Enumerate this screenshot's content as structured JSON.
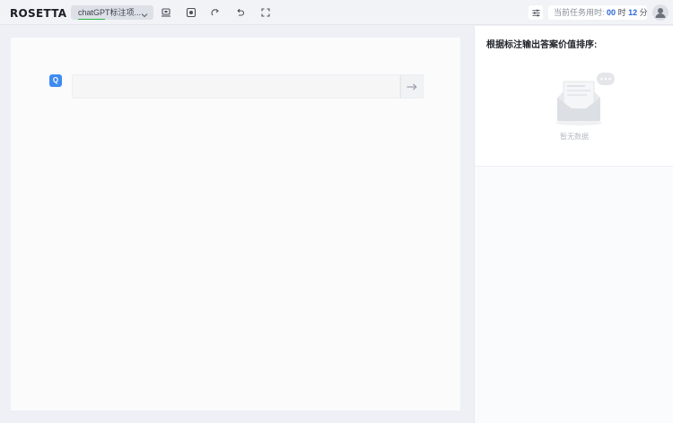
{
  "header": {
    "logo": "ROSETTA",
    "task_select": "chatGPT标注项...",
    "toolbar_icons": [
      "monitor-icon",
      "record-icon",
      "redo-icon",
      "undo-icon",
      "fullscreen-icon"
    ],
    "timer": {
      "prefix": "当前任务用时:",
      "hours": "00",
      "hours_unit": "时",
      "minutes": "12",
      "minutes_unit": "分"
    }
  },
  "question": {
    "badge": "Q",
    "value": "",
    "placeholder": ""
  },
  "sidebar": {
    "title": "根据标注输出答案价值排序:",
    "empty_text": "暂无数据"
  },
  "colors": {
    "accent": "#3d8bf2",
    "timer_number": "#2b66d9",
    "select_underline": "#2db84a"
  }
}
